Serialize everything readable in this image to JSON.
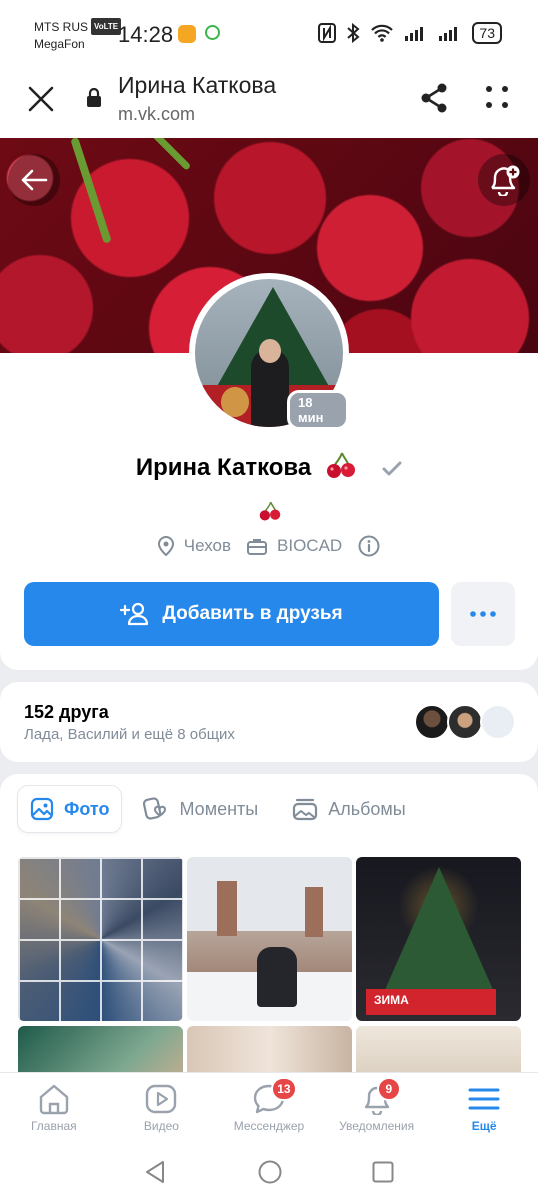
{
  "status_bar": {
    "carrier_1": "MTS RUS",
    "volte": "VoLTE",
    "carrier_2": "MegaFon",
    "time": "14:28",
    "battery": "73"
  },
  "browser": {
    "title": "Ирина Каткова",
    "url": "m.vk.com"
  },
  "profile": {
    "online_badge": "18 мин",
    "name": "Ирина Каткова",
    "name_emoji": "cherry",
    "status_emoji": "cherry",
    "city": "Чехов",
    "company": "BIOCAD",
    "add_friend_label": "Добавить в друзья"
  },
  "friends": {
    "count_label": "152 друга",
    "mutual_label": "Лада, Василий и ещё 8 общих"
  },
  "media_tabs": [
    {
      "label": "Фото",
      "icon": "photo-icon",
      "active": true
    },
    {
      "label": "Моменты",
      "icon": "moments-icon",
      "active": false
    },
    {
      "label": "Альбомы",
      "icon": "albums-icon",
      "active": false
    }
  ],
  "photo_overlay_text": "ЗИМА",
  "bottom_nav": [
    {
      "label": "Главная",
      "icon": "home-icon"
    },
    {
      "label": "Видео",
      "icon": "video-icon"
    },
    {
      "label": "Мессенджер",
      "icon": "messenger-icon",
      "badge": "13"
    },
    {
      "label": "Уведомления",
      "icon": "bell-icon",
      "badge": "9"
    },
    {
      "label": "Ещё",
      "icon": "menu-icon",
      "active": true
    }
  ],
  "colors": {
    "accent": "#2688eb",
    "badge": "#e64646",
    "secondary_text": "#818c99"
  }
}
